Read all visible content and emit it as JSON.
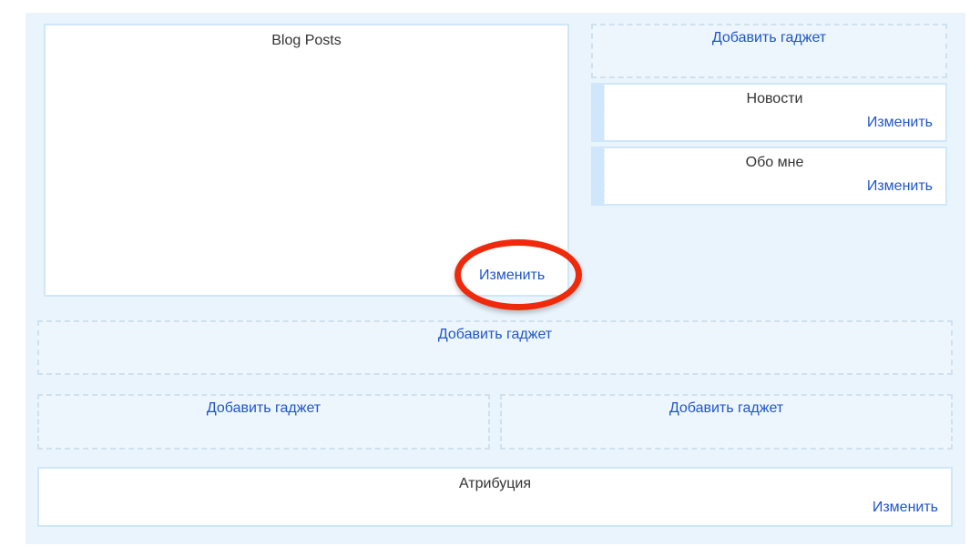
{
  "main_column": {
    "blog_posts": {
      "title": "Blog Posts",
      "edit_label": "Изменить"
    }
  },
  "sidebar": {
    "add_gadget_label": "Добавить гаджет",
    "gadgets": [
      {
        "title": "Новости",
        "edit_label": "Изменить"
      },
      {
        "title": "Обо мне",
        "edit_label": "Изменить"
      }
    ]
  },
  "footer": {
    "add_gadget_full": "Добавить гаджет",
    "add_gadget_left": "Добавить гаджет",
    "add_gadget_right": "Добавить гаджет",
    "attribution": {
      "title": "Атрибуция",
      "edit_label": "Изменить"
    }
  },
  "highlight": {
    "color": "#ef2a0c"
  }
}
